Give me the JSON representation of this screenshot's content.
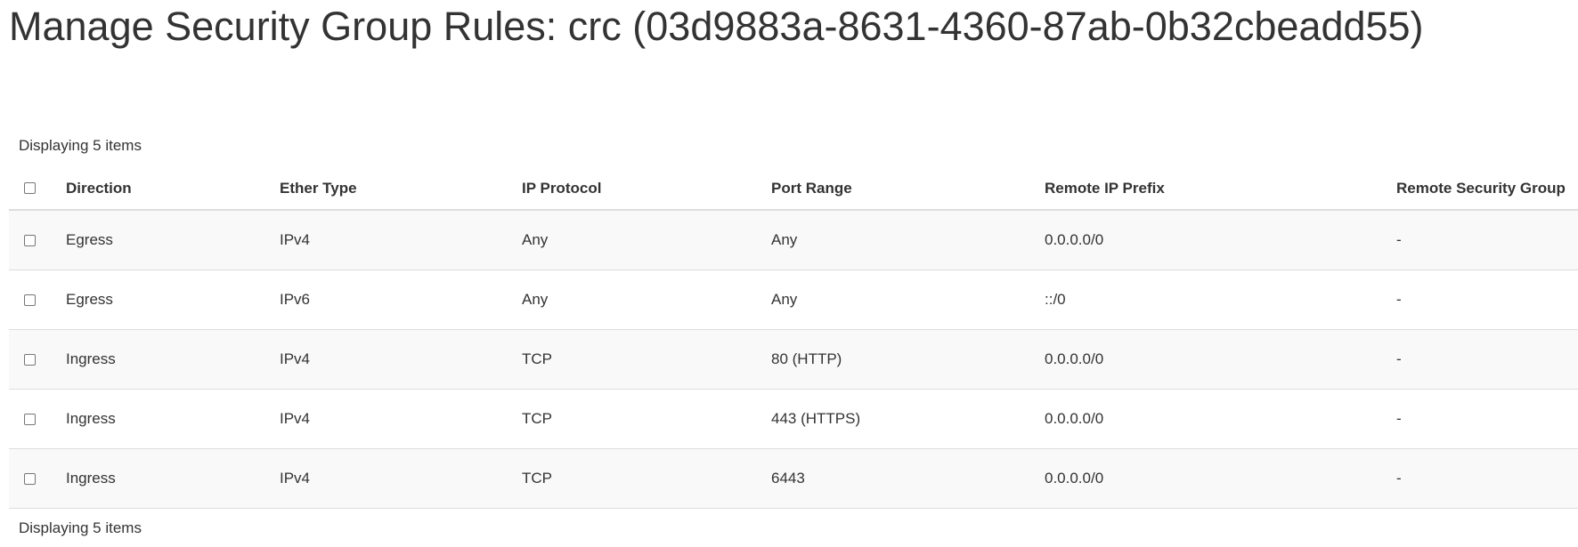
{
  "page": {
    "title": "Manage Security Group Rules: crc (03d9883a-8631-4360-87ab-0b32cbeadd55)"
  },
  "table": {
    "summary_top": "Displaying 5 items",
    "summary_bottom": "Displaying 5 items",
    "columns": {
      "direction": "Direction",
      "ether_type": "Ether Type",
      "ip_protocol": "IP Protocol",
      "port_range": "Port Range",
      "remote_ip_prefix": "Remote IP Prefix",
      "remote_security_group": "Remote Security Group"
    },
    "rows": [
      {
        "direction": "Egress",
        "ether_type": "IPv4",
        "ip_protocol": "Any",
        "port_range": "Any",
        "remote_ip_prefix": "0.0.0.0/0",
        "remote_security_group": "-"
      },
      {
        "direction": "Egress",
        "ether_type": "IPv6",
        "ip_protocol": "Any",
        "port_range": "Any",
        "remote_ip_prefix": "::/0",
        "remote_security_group": "-"
      },
      {
        "direction": "Ingress",
        "ether_type": "IPv4",
        "ip_protocol": "TCP",
        "port_range": "80 (HTTP)",
        "remote_ip_prefix": "0.0.0.0/0",
        "remote_security_group": "-"
      },
      {
        "direction": "Ingress",
        "ether_type": "IPv4",
        "ip_protocol": "TCP",
        "port_range": "443 (HTTPS)",
        "remote_ip_prefix": "0.0.0.0/0",
        "remote_security_group": "-"
      },
      {
        "direction": "Ingress",
        "ether_type": "IPv4",
        "ip_protocol": "TCP",
        "port_range": "6443",
        "remote_ip_prefix": "0.0.0.0/0",
        "remote_security_group": "-"
      }
    ]
  }
}
